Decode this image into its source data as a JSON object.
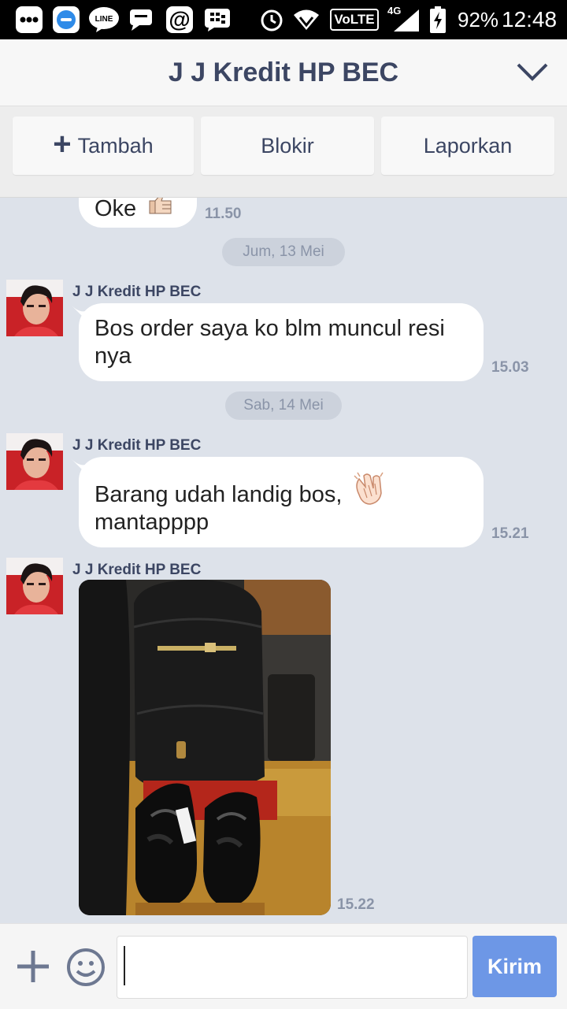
{
  "status_bar": {
    "notif_icons": [
      "chat-dots-icon",
      "browser-icon",
      "line-icon",
      "message-icon",
      "at-icon",
      "bbm-icon"
    ],
    "line_label": "LINE",
    "volte": "VoLTE",
    "network": "4G",
    "battery": "92%",
    "time": "12:48"
  },
  "header": {
    "title": "J J Kredit HP BEC"
  },
  "actions": {
    "add_label": "Tambah",
    "block_label": "Blokir",
    "report_label": "Laporkan"
  },
  "chat": {
    "partial_message": {
      "text": "Oke",
      "time": "11.50"
    },
    "date1": "Jum, 13 Mei",
    "msg1": {
      "sender": "J J Kredit HP BEC",
      "text": "Bos order saya ko blm muncul resi nya",
      "time": "15.03"
    },
    "date2": "Sab, 14 Mei",
    "msg2": {
      "sender": "J J Kredit HP BEC",
      "text_line1": "Barang udah landig bos,",
      "text_line2": "mantapppp",
      "time": "15.21"
    },
    "msg3": {
      "sender": "J J Kredit HP BEC",
      "time": "15.22"
    }
  },
  "input": {
    "value": "",
    "send_label": "Kirim"
  },
  "colors": {
    "accent": "#6d97e6",
    "header_text": "#3c4663",
    "chat_bg": "#dde2ea",
    "timestamp": "#8a94a8"
  }
}
